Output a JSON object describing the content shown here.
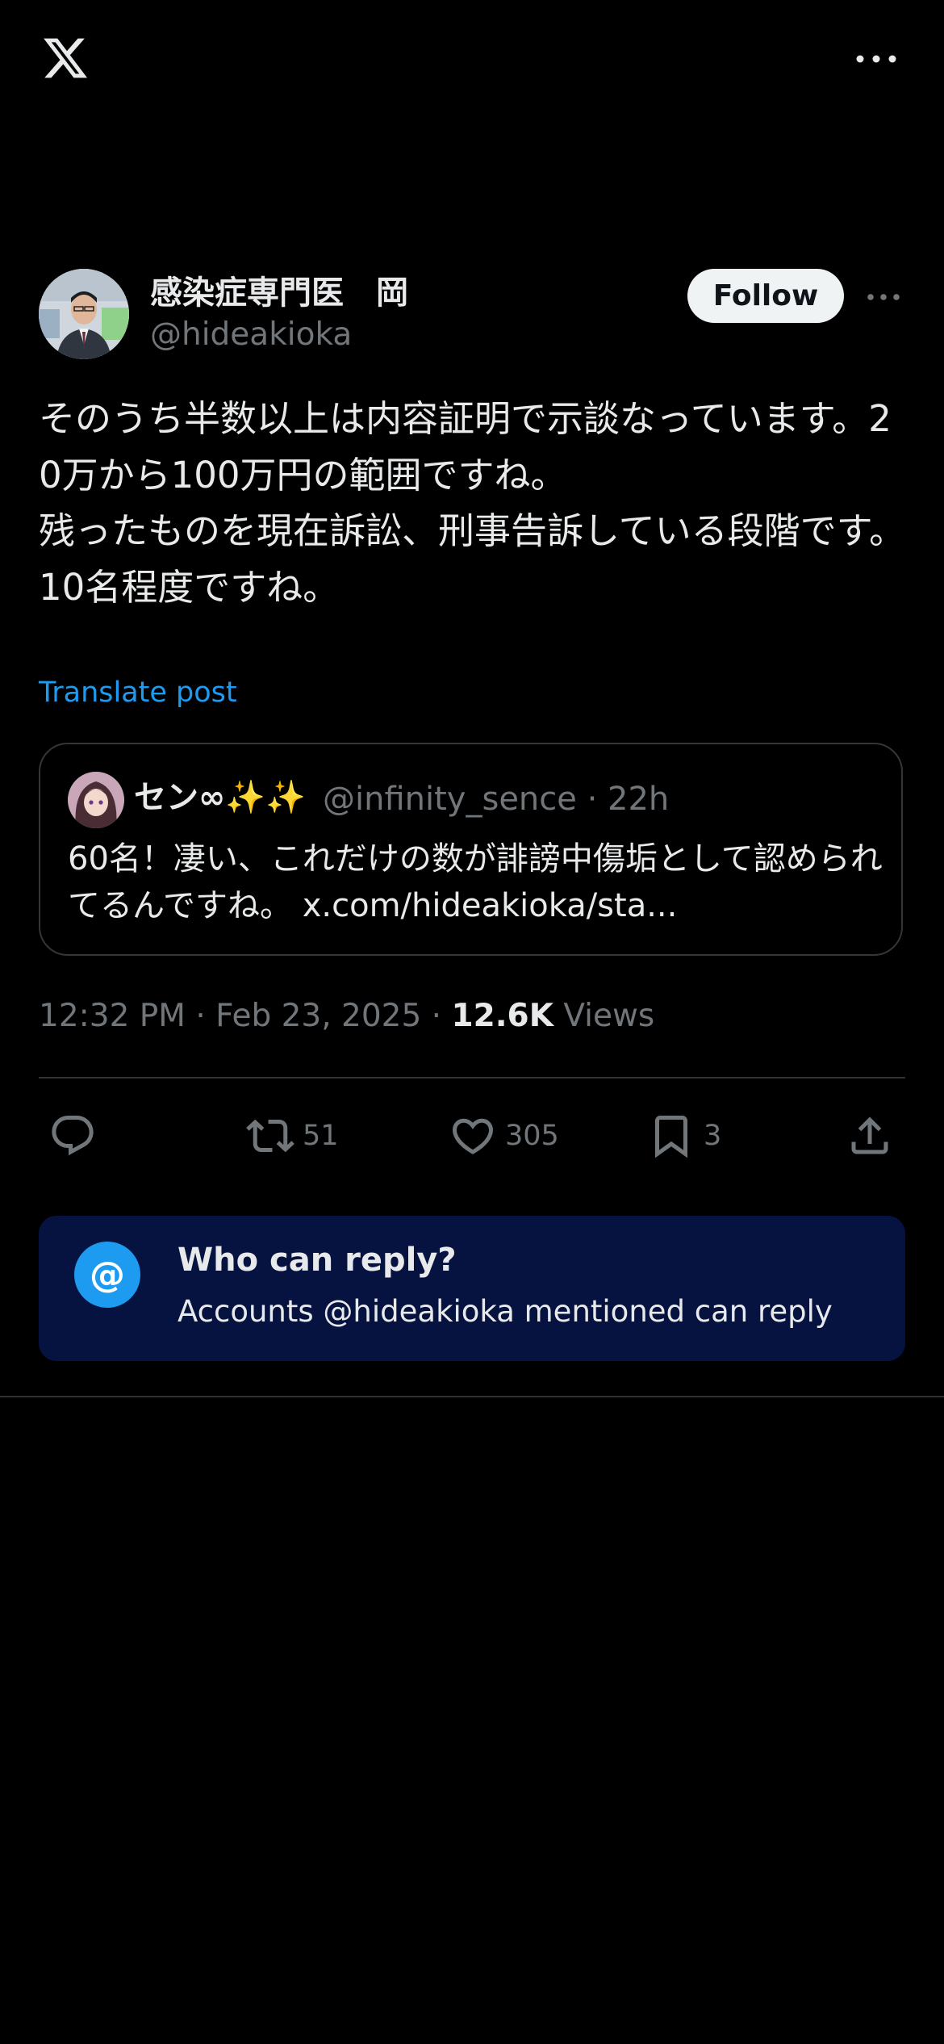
{
  "app": {
    "logo_icon": "x-logo-icon",
    "more_icon": "more-horizontal-icon"
  },
  "tweet": {
    "author": {
      "display_name": "感染症専門医　岡",
      "handle": "@hideakioka",
      "follow_label": "Follow"
    },
    "text": "そのうち半数以上は内容証明で示談なっています。20万から100万円の範囲ですね。\n残ったものを現在訴訟、刑事告訴している段階です。\n10名程度ですね。",
    "translate_label": "Translate post",
    "quote": {
      "display_name": "セン∞✨✨",
      "meta": "@infinity_sence · 22h",
      "text": "60名！凄い、これだけの数が誹謗中傷垢として認められてるんですね。 x.com/hideakioka/sta..."
    },
    "timestamp": "12:32 PM · Feb 23, 2025 · ",
    "views_count": "12.6K",
    "views_label": " Views",
    "actions": {
      "reply_icon": "reply-icon",
      "repost_icon": "repost-icon",
      "repost_count": "51",
      "like_icon": "heart-icon",
      "like_count": "305",
      "bookmark_icon": "bookmark-icon",
      "bookmark_count": "3",
      "share_icon": "share-icon"
    }
  },
  "who_can_reply": {
    "icon": "@",
    "title": "Who can reply?",
    "subtitle": "Accounts @hideakioka mentioned can reply"
  },
  "colors": {
    "background": "#000000",
    "text": "#e7e9ea",
    "secondary": "#71767b",
    "accent": "#1d9bf0",
    "card": "#061340"
  }
}
